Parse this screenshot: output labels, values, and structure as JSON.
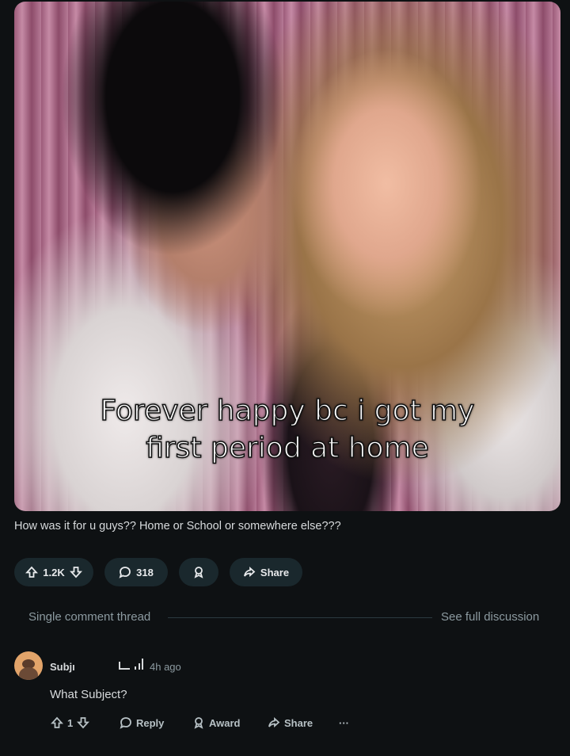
{
  "post": {
    "image_caption_line1": "Forever happy bc i got my",
    "image_caption_line2": "first period at home",
    "body": "How was it for u guys?? Home or School or somewhere else???",
    "vote_count": "1.2K",
    "comment_count": "318",
    "share_label": "Share"
  },
  "thread": {
    "label": "Single comment thread",
    "full_discussion_link": "See full discussion"
  },
  "comment": {
    "username": "Subjı",
    "timestamp": "4h ago",
    "text": "What Subject?",
    "vote_count": "1",
    "reply_label": "Reply",
    "award_label": "Award",
    "share_label": "Share",
    "more_label": "···"
  },
  "icons": {
    "upvote": "arrow-up-icon",
    "downvote": "arrow-down-icon",
    "comment": "speech-bubble-icon",
    "award": "award-ribbon-icon",
    "share": "share-arrow-icon"
  },
  "colors": {
    "background": "#0e1113",
    "pill": "#1a282d",
    "muted_text": "#8c9aa0"
  }
}
